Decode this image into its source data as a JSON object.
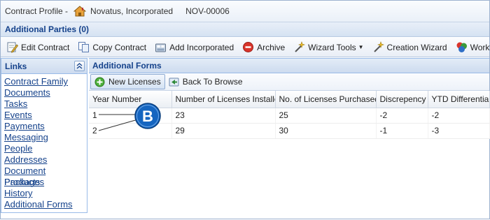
{
  "header": {
    "profile_label": "Contract Profile -",
    "company": "Novatus, Incorporated",
    "contract_number": "NOV-00006"
  },
  "parties": {
    "label": "Additional Parties (0)"
  },
  "toolbar": {
    "edit_contract": "Edit Contract",
    "copy_contract": "Copy Contract",
    "add_incorporated": "Add Incorporated",
    "archive": "Archive",
    "wizard_tools": "Wizard Tools",
    "creation_wizard": "Creation Wizard",
    "workflows": "Workflows"
  },
  "sidebar": {
    "title": "Links",
    "items": [
      "Contract Family",
      "Documents",
      "Tasks",
      "Events",
      "Payments",
      "Messaging",
      "People",
      "Addresses",
      "Document Packages",
      "Products",
      "History",
      "Additional Forms"
    ]
  },
  "main": {
    "title": "Additional Forms",
    "new_licenses": "New Licenses",
    "back_to_browse": "Back To Browse",
    "columns": [
      "Year Number",
      "Number of Licenses Installed",
      "No. of Licenses Purchased",
      "Discrepency",
      "YTD Differential"
    ],
    "rows": [
      [
        "1",
        "23",
        "25",
        "-2",
        "-2"
      ],
      [
        "2",
        "29",
        "30",
        "-1",
        "-3"
      ]
    ]
  },
  "callout": {
    "letter": "B"
  },
  "colors": {
    "accent": "#15428b",
    "callout_blue": "#1565c0"
  }
}
